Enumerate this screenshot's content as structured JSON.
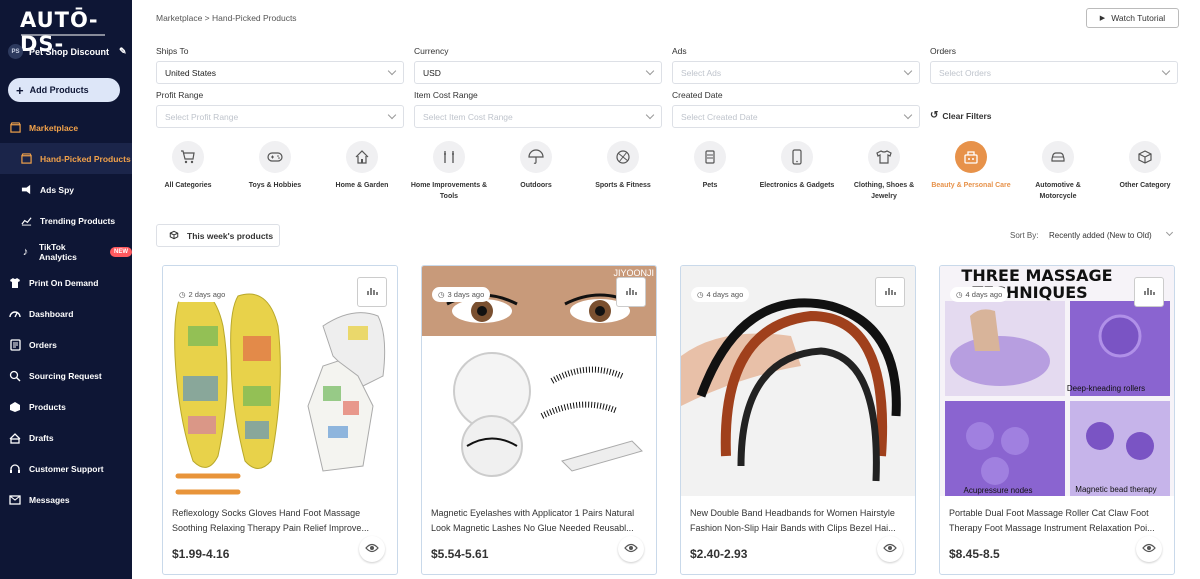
{
  "brand": {
    "logo": "AUTŌ-DS-"
  },
  "store": {
    "initials": "PS",
    "name": "Pet Shop Discount"
  },
  "sidebar": {
    "add_label": "Add Products",
    "items": [
      {
        "label": "Marketplace"
      },
      {
        "label": "Hand-Picked Products"
      },
      {
        "label": "Ads Spy"
      },
      {
        "label": "Trending Products"
      },
      {
        "label": "TikTok Analytics",
        "badge": "NEW"
      },
      {
        "label": "Print On Demand"
      },
      {
        "label": "Dashboard"
      },
      {
        "label": "Orders"
      },
      {
        "label": "Sourcing Request"
      },
      {
        "label": "Products"
      },
      {
        "label": "Drafts"
      },
      {
        "label": "Customer Support"
      },
      {
        "label": "Messages"
      }
    ]
  },
  "header": {
    "breadcrumb": "Marketplace > Hand-Picked Products",
    "tutorial": "Watch Tutorial"
  },
  "filters": {
    "ships_to": {
      "label": "Ships To",
      "value": "United States"
    },
    "currency": {
      "label": "Currency",
      "value": "USD"
    },
    "ads": {
      "label": "Ads",
      "placeholder": "Select Ads"
    },
    "orders": {
      "label": "Orders",
      "placeholder": "Select Orders"
    },
    "profit": {
      "label": "Profit Range",
      "placeholder": "Select Profit Range"
    },
    "item_cost": {
      "label": "Item Cost Range",
      "placeholder": "Select Item Cost Range"
    },
    "created": {
      "label": "Created Date",
      "placeholder": "Select Created Date"
    },
    "clear": "Clear Filters"
  },
  "categories": [
    {
      "label": "All Categories",
      "icon": "cart-icon"
    },
    {
      "label": "Toys & Hobbies",
      "icon": "gamepad-icon"
    },
    {
      "label": "Home & Garden",
      "icon": "house-icon"
    },
    {
      "label": "Home Improvements & Tools",
      "icon": "tools-icon"
    },
    {
      "label": "Outdoors",
      "icon": "umbrella-icon"
    },
    {
      "label": "Sports & Fitness",
      "icon": "ball-icon"
    },
    {
      "label": "Pets",
      "icon": "pet-food-icon"
    },
    {
      "label": "Electronics & Gadgets",
      "icon": "phone-icon"
    },
    {
      "label": "Clothing, Shoes & Jewelry",
      "icon": "shirt-icon"
    },
    {
      "label": "Beauty & Personal Care",
      "icon": "makeup-icon",
      "selected": true
    },
    {
      "label": "Automotive & Motorcycle",
      "icon": "car-icon"
    },
    {
      "label": "Other Category",
      "icon": "box-icon"
    }
  ],
  "week_button": "This week's products",
  "sort": {
    "label": "Sort By:",
    "value": "Recently added (New to Old)"
  },
  "products": [
    {
      "age": "2 days ago",
      "title1": "Reflexology Socks Gloves Hand Foot Massage",
      "title2": "Soothing Relaxing Therapy Pain Relief Improve...",
      "price": "$1.99-4.16"
    },
    {
      "age": "3 days ago",
      "title1": "Magnetic Eyelashes with Applicator 1 Pairs Natural",
      "title2": "Look Magnetic Lashes No Glue Needed Reusabl...",
      "price": "$5.54-5.61",
      "overlay": "JIYOONJI"
    },
    {
      "age": "4 days ago",
      "title1": "New Double Band Headbands for Women Hairstyle",
      "title2": "Fashion Non-Slip Hair Bands with Clips Bezel Hai...",
      "price": "$2.40-2.93"
    },
    {
      "age": "4 days ago",
      "title1": "Portable Dual Foot Massage Roller Cat Claw Foot",
      "title2": "Therapy Foot Massage Instrument Relaxation Poi...",
      "price": "$8.45-8.5",
      "overlay1": "THREE MASSAGE",
      "overlay2": "TECHNIQUES",
      "cap1": "Deep-kneading rollers",
      "cap2": "Acupressure nodes",
      "cap3": "Magnetic bead therapy"
    }
  ]
}
